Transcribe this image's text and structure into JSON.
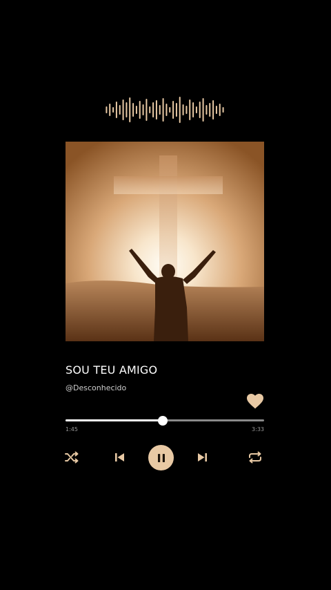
{
  "track": {
    "title": "SOU TEU AMIGO",
    "artist": "@Desconhecido"
  },
  "playback": {
    "elapsed": "1:45",
    "total": "3:33",
    "progress_fraction": 0.49,
    "state": "playing"
  },
  "icons": {
    "waveform": "waveform-icon",
    "heart": "heart-icon",
    "shuffle": "shuffle-icon",
    "previous": "skip-previous-icon",
    "pause": "pause-icon",
    "next": "skip-next-icon",
    "repeat": "repeat-icon"
  },
  "colors": {
    "background": "#000000",
    "accent": "#e8c9a4",
    "heart": "#e8c9a4",
    "progress_fill": "#ffffff",
    "progress_track": "#8a8a8a"
  }
}
